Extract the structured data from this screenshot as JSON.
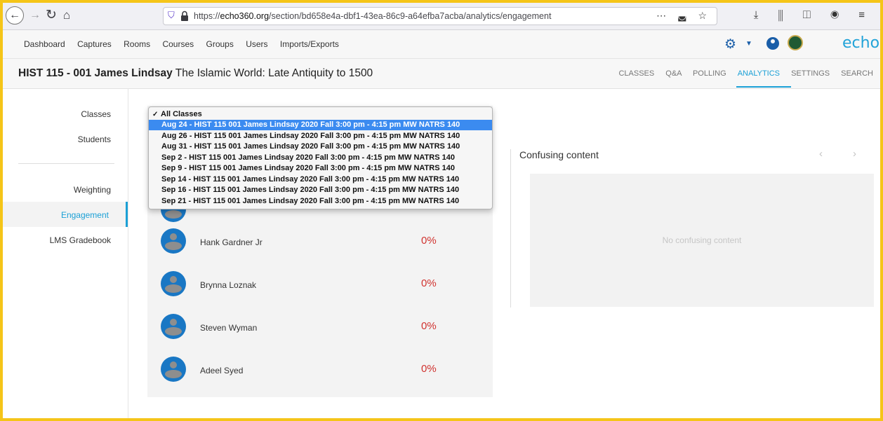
{
  "browser": {
    "url_prefix": "https://",
    "url_domain": "echo360.org",
    "url_path": "/section/bd658e4a-dbf1-43ea-86c9-a64efba7acba/analytics/engagement",
    "url_actions": "⋯ ◛ ☆",
    "toolbar_icons": "⤓ ⫼ ◫ ◉ ≡"
  },
  "nav": {
    "links": [
      "Dashboard",
      "Captures",
      "Rooms",
      "Courses",
      "Groups",
      "Users",
      "Imports/Exports"
    ],
    "logo": "echo"
  },
  "course": {
    "code": "HIST 115 - 001 James Lindsay",
    "name": "The Islamic World: Late Antiquity to 1500",
    "tabs": [
      "CLASSES",
      "Q&A",
      "POLLING",
      "ANALYTICS",
      "SETTINGS",
      "SEARCH"
    ],
    "active_tab": "ANALYTICS"
  },
  "sidebar": {
    "items": [
      "Classes",
      "Students",
      "Weighting",
      "Engagement",
      "LMS Gradebook"
    ],
    "active": "Engagement"
  },
  "class_dropdown": {
    "checked_option": "All Classes",
    "highlighted_index": 1,
    "options": [
      "All Classes",
      "Aug 24 - HIST 115 001 James Lindsay 2020 Fall 3:00 pm - 4:15 pm MW NATRS 140",
      "Aug 26 - HIST 115 001 James Lindsay 2020 Fall 3:00 pm - 4:15 pm MW NATRS 140",
      "Aug 31 - HIST 115 001 James Lindsay 2020 Fall 3:00 pm - 4:15 pm MW NATRS 140",
      "Sep 2 - HIST 115 001 James Lindsay 2020 Fall 3:00 pm - 4:15 pm MW NATRS 140",
      "Sep 9 - HIST 115 001 James Lindsay 2020 Fall 3:00 pm - 4:15 pm MW NATRS 140",
      "Sep 14 - HIST 115 001 James Lindsay 2020 Fall 3:00 pm - 4:15 pm MW NATRS 140",
      "Sep 16 - HIST 115 001 James Lindsay 2020 Fall 3:00 pm - 4:15 pm MW NATRS 140",
      "Sep 21 - HIST 115 001 James Lindsay 2020 Fall 3:00 pm - 4:15 pm MW NATRS 140"
    ]
  },
  "students": [
    {
      "name": "Hank Gardner Jr",
      "engagement": "0%"
    },
    {
      "name": "Brynna Loznak",
      "engagement": "0%"
    },
    {
      "name": "Steven Wyman",
      "engagement": "0%"
    },
    {
      "name": "Adeel Syed",
      "engagement": "0%"
    }
  ],
  "confusing": {
    "title": "Confusing content",
    "empty_text": "No confusing content",
    "prev": "‹",
    "next": "›"
  },
  "colors": {
    "accent": "#1ba0d6",
    "highlight": "#f5c518",
    "pct": "#d0322f",
    "avatar": "#1977c4"
  }
}
